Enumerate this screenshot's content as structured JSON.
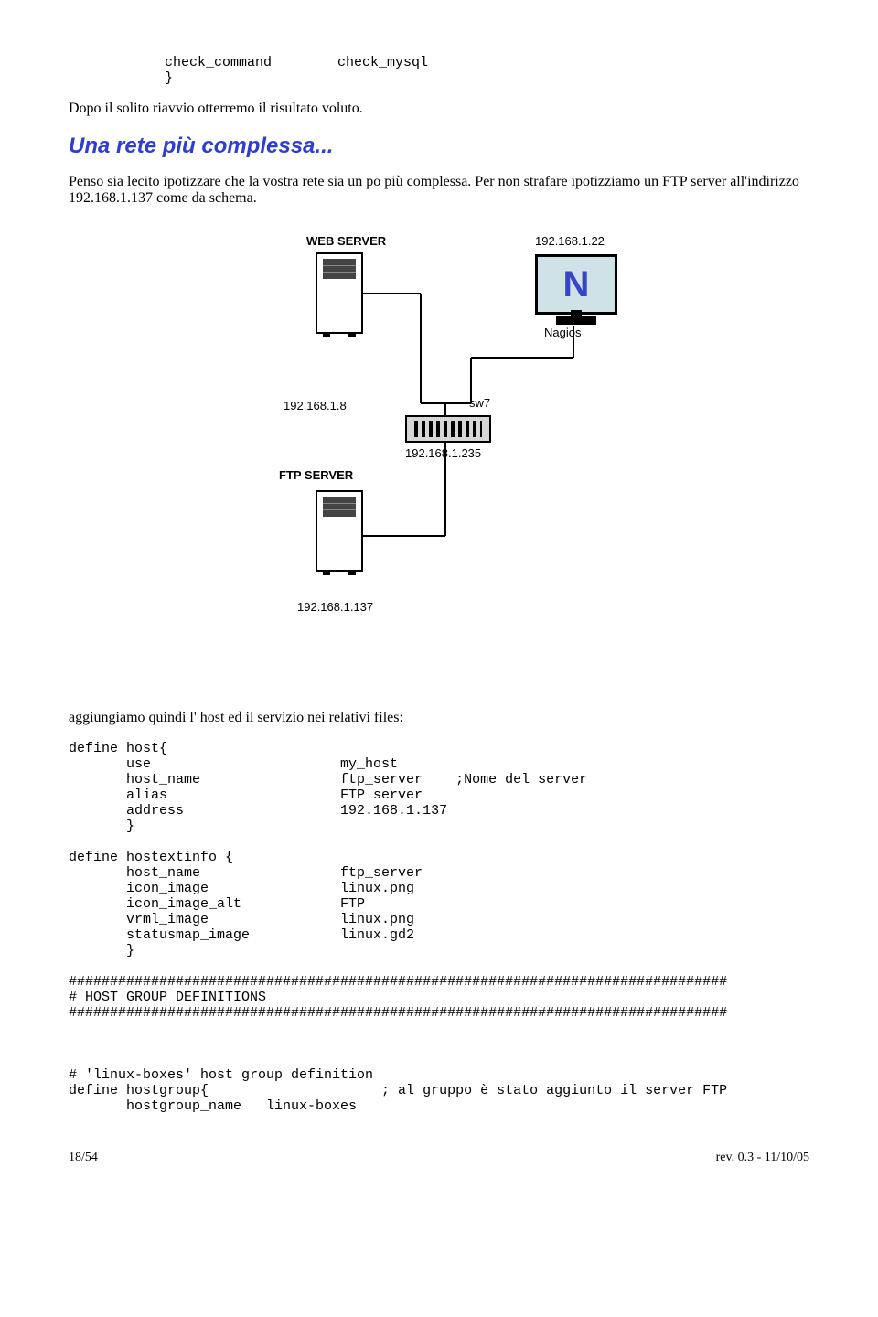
{
  "code_top": "     check_command        check_mysql\n     }",
  "para1": "Dopo il solito riavvio otterremo il risultato voluto.",
  "heading": "Una rete più complessa...",
  "para2": "Penso sia lecito ipotizzare che la vostra rete sia un po più complessa. Per non strafare ipotizziamo un FTP server all'indirizzo 192.168.1.137 come da schema.",
  "diagram": {
    "webserver": "WEB SERVER",
    "ftpserver": "FTP SERVER",
    "nagios_ip": "192.168.1.22",
    "nagios_label": "Nagios",
    "web_ip": "192.168.1.8",
    "sw_label": "sw7",
    "sw_ip": "192.168.1.235",
    "ftp_ip": "192.168.1.137"
  },
  "para3": "aggiungiamo quindi l' host ed il servizio nei relativi files:",
  "code_host": "define host{\n       use                       my_host\n       host_name                 ftp_server    ;Nome del server\n       alias                     FTP server\n       address                   192.168.1.137\n       }\n\ndefine hostextinfo {\n       host_name                 ftp_server\n       icon_image                linux.png\n       icon_image_alt            FTP\n       vrml_image                linux.png\n       statusmap_image           linux.gd2\n       }\n\n################################################################################\n# HOST GROUP DEFINITIONS\n################################################################################\n\n\n\n# 'linux-boxes' host group definition\ndefine hostgroup{                     ; al gruppo è stato aggiunto il server FTP\n       hostgroup_name   linux-boxes",
  "footer_left": "18/54",
  "footer_right": "rev. 0.3 - 11/10/05"
}
